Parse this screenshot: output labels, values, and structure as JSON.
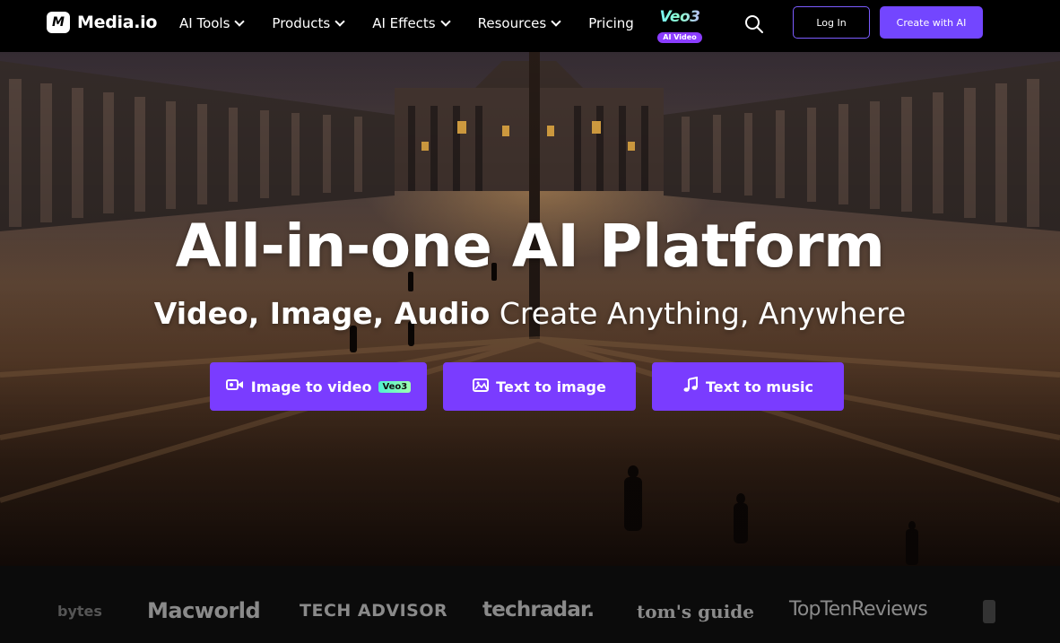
{
  "nav": {
    "logo_mark": "M",
    "logo_text": "Media.io",
    "menu": [
      {
        "label": "AI Tools",
        "has_dropdown": true
      },
      {
        "label": "Products",
        "has_dropdown": true
      },
      {
        "label": "AI Effects",
        "has_dropdown": true
      },
      {
        "label": "Resources",
        "has_dropdown": true
      },
      {
        "label": "Pricing",
        "has_dropdown": false
      }
    ],
    "promo": {
      "title": "Veo3",
      "badge": "AI Video"
    },
    "search_icon": "search-icon",
    "login_label": "Log In",
    "create_label": "Create with AI"
  },
  "hero": {
    "headline": "All-in-one AI Platform",
    "subline_bold": "Video, Image, Audio",
    "subline_rest": " Create Anything, Anywhere",
    "ctas": [
      {
        "label": "Image to video",
        "icon": "video-camera-icon",
        "badge": "Veo3"
      },
      {
        "label": "Text to image",
        "icon": "image-icon"
      },
      {
        "label": "Text to music",
        "icon": "music-note-icon"
      }
    ]
  },
  "press": [
    "bytes",
    "Macworld",
    "TECH ADVISOR",
    "techradar.",
    "tom's guide",
    "TopTenReviews"
  ],
  "colors": {
    "accent": "#7346ff",
    "cta": "#7a3cff",
    "outline": "#7b5cff",
    "nav_bg": "#000000"
  }
}
